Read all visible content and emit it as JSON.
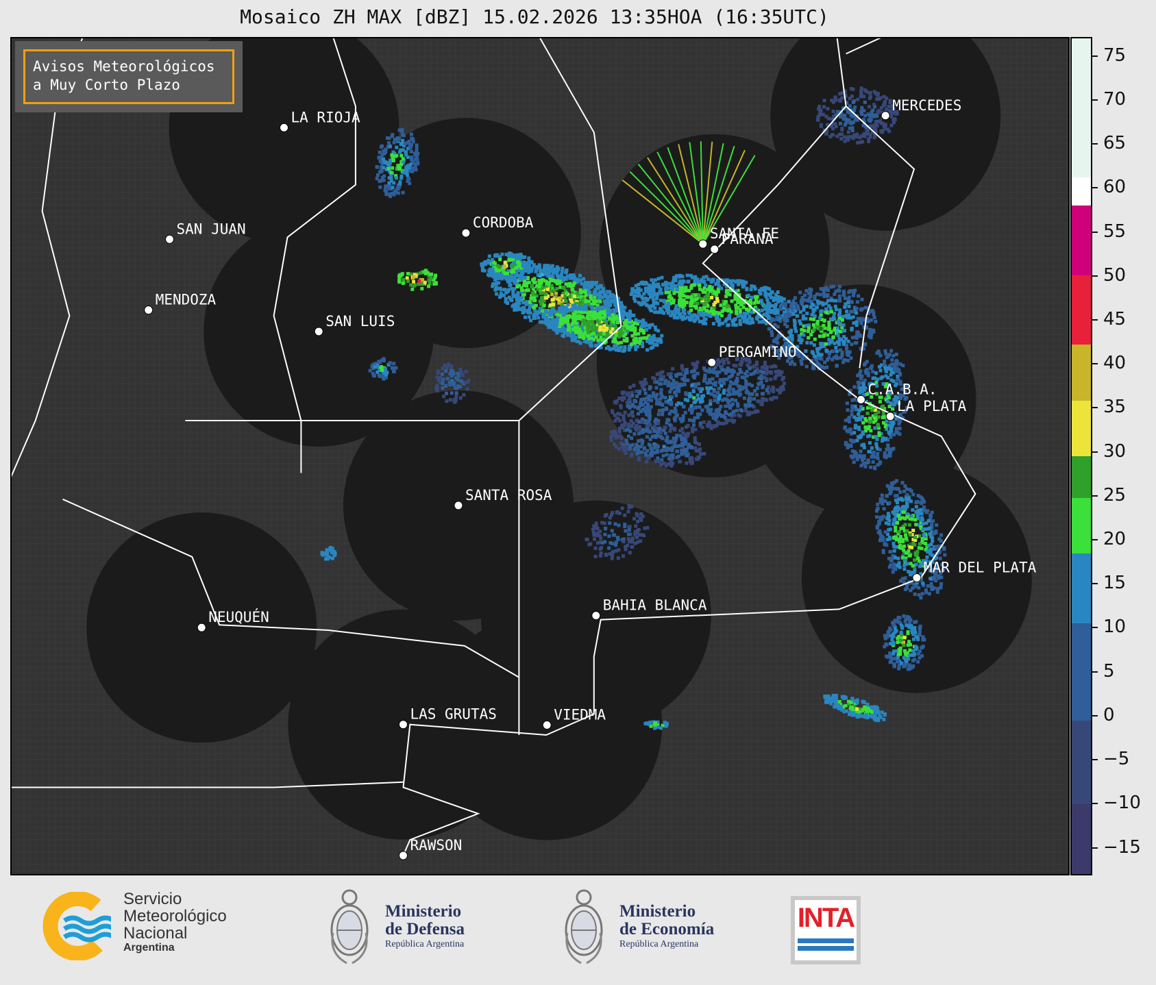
{
  "title": "Mosaico ZH MAX [dBZ] 15.02.2026 13:35HOA (16:35UTC)",
  "notice": {
    "line1": "Avisos Meteorológicos",
    "line2": "a Muy Corto Plazo",
    "border_color": "#f0a010"
  },
  "colorbar": {
    "unit": "dBZ",
    "ticks": [
      "75",
      "70",
      "65",
      "60",
      "55",
      "50",
      "45",
      "40",
      "35",
      "30",
      "25",
      "20",
      "15",
      "10",
      "5",
      "0",
      "−5",
      "−10",
      "−15"
    ],
    "range": [
      -18,
      77
    ],
    "stops": [
      {
        "value": -18,
        "color": "#3c3a6a"
      },
      {
        "value": -10,
        "color": "#374878"
      },
      {
        "value": 0,
        "color": "#2f5e98"
      },
      {
        "value": 10,
        "color": "#2a86c0"
      },
      {
        "value": 18,
        "color": "#2cb0e0"
      },
      {
        "value": 18.01,
        "color": "#3be03a"
      },
      {
        "value": 25,
        "color": "#2fa02a"
      },
      {
        "value": 30,
        "color": "#1f6a1f"
      },
      {
        "value": 30.01,
        "color": "#ede43a"
      },
      {
        "value": 36,
        "color": "#c8b52a"
      },
      {
        "value": 42,
        "color": "#e07a15"
      },
      {
        "value": 42.01,
        "color": "#e8203a"
      },
      {
        "value": 50,
        "color": "#8a0010"
      },
      {
        "value": 50.01,
        "color": "#d0007a"
      },
      {
        "value": 58,
        "color": "#8a0aa8"
      },
      {
        "value": 58.01,
        "color": "#ffffff"
      },
      {
        "value": 61,
        "color": "#e6f6ee"
      },
      {
        "value": 77,
        "color": "#7cd8b4"
      }
    ]
  },
  "cities": [
    {
      "name": "LA RIOJA",
      "lon": -66.85,
      "lat": -29.41
    },
    {
      "name": "CORDOBA",
      "lon": -64.18,
      "lat": -31.42
    },
    {
      "name": "SAN JUAN",
      "lon": -68.53,
      "lat": -31.54
    },
    {
      "name": "SANTA FE",
      "lon": -60.7,
      "lat": -31.63
    },
    {
      "name": "PARANA",
      "lon": -60.53,
      "lat": -31.73
    },
    {
      "name": "MERCEDES",
      "lon": -58.02,
      "lat": -29.18
    },
    {
      "name": "MENDOZA",
      "lon": -68.84,
      "lat": -32.89
    },
    {
      "name": "SAN LUIS",
      "lon": -66.34,
      "lat": -33.3
    },
    {
      "name": "PERGAMINO",
      "lon": -60.57,
      "lat": -33.89
    },
    {
      "name": "C.A.B.A.",
      "lon": -58.38,
      "lat": -34.6
    },
    {
      "name": "LA PLATA",
      "lon": -57.95,
      "lat": -34.92
    },
    {
      "name": "SANTA ROSA",
      "lon": -64.29,
      "lat": -36.62
    },
    {
      "name": "MAR DEL PLATA",
      "lon": -57.56,
      "lat": -38.0
    },
    {
      "name": "BAHIA BLANCA",
      "lon": -62.27,
      "lat": -38.72
    },
    {
      "name": "NEUQUÉN",
      "lon": -68.06,
      "lat": -38.95
    },
    {
      "name": "LAS GRUTAS",
      "lon": -65.1,
      "lat": -40.8
    },
    {
      "name": "VIEDMA",
      "lon": -62.99,
      "lat": -40.81
    },
    {
      "name": "RAWSON",
      "lon": -65.1,
      "lat": -43.3
    }
  ],
  "radars": [
    {
      "name": "LA RIOJA"
    },
    {
      "name": "CORDOBA"
    },
    {
      "name": "PARANA"
    },
    {
      "name": "MERCEDES"
    },
    {
      "name": "SAN LUIS"
    },
    {
      "name": "PERGAMINO"
    },
    {
      "name": "C.A.B.A."
    },
    {
      "name": "MAR DEL PLATA"
    },
    {
      "name": "SANTA ROSA"
    },
    {
      "name": "BAHIA BLANCA"
    },
    {
      "name": "NEUQUÉN"
    },
    {
      "name": "VIEDMA"
    },
    {
      "name": "LAS GRUTAS"
    }
  ],
  "logos": {
    "smn": {
      "line1": "Servicio",
      "line2": "Meteorológico",
      "line3": "Nacional",
      "line4": "Argentina",
      "color_yellow": "#f9b31b",
      "color_blue": "#1e9ed8"
    },
    "defensa": {
      "line1": "Ministerio",
      "line2": "de Defensa",
      "line3": "República Argentina",
      "color": "#2a3560"
    },
    "economia": {
      "line1": "Ministerio",
      "line2": "de Economía",
      "line3": "República Argentina",
      "color": "#2a3560"
    },
    "inta": {
      "text": "INTA",
      "color_red": "#e3202a",
      "color_blue": "#2a78c0"
    }
  }
}
